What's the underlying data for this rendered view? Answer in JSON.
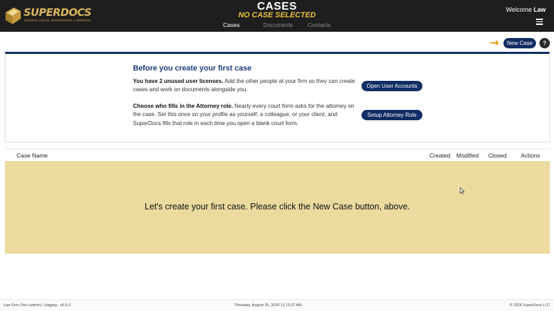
{
  "header": {
    "logo_text": "SUPERDOCS",
    "logo_tagline": "MAKING LEGAL PAPERWORK A BREEZE",
    "title": "CASES",
    "subtitle": "NO CASE SELECTED",
    "welcome_prefix": "Welcome",
    "user_name": "Law",
    "tabs": [
      {
        "label": "Cases",
        "active": true
      },
      {
        "label": "Documents",
        "active": false
      },
      {
        "label": "Contacts",
        "active": false
      }
    ],
    "colors": {
      "background": "#1e1e1e",
      "subtitle": "#e9c23c",
      "brand": "#0f2d63"
    }
  },
  "toolbar": {
    "new_case_label": "New Case",
    "help_label": "?"
  },
  "intro": {
    "heading": "Before you create your first case",
    "licenses_bold": "You have 2 unused user licenses.",
    "licenses_text": " Add the other people at your firm so they can create cases and work on documents alongside you.",
    "open_users_label": "Open User Accounts",
    "attorney_bold": "Choose who fills in the Attorney role.",
    "attorney_text": " Nearly every court form asks for the attorney on the case. Set this once on your profile as yourself, a colleague, or your client, and SuperDocs fills that role in each time you open a blank court form.",
    "setup_attorney_label": "Setup Attorney Role"
  },
  "table": {
    "columns": [
      "Case Name",
      "Created",
      "Modified",
      "Closed",
      "Actions"
    ],
    "empty_message": "Let's create your first case. Please click the New Case button, above.",
    "empty_color": "#ebdb9f"
  },
  "footer": {
    "left": "Law Firm One (admin) / staging - v6.5.0",
    "center": "Thursday, August 20, 2026 11:13:27 AM",
    "right": "© 2026 SuperDocs LLC"
  }
}
